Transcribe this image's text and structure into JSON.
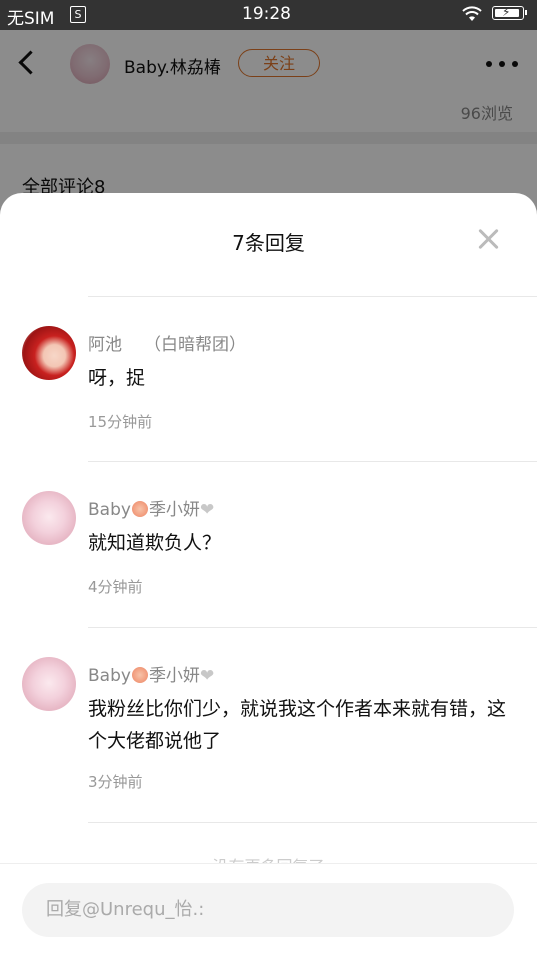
{
  "status_bar": {
    "carrier": "无SIM",
    "carrier_badge": "S",
    "time": "19:28",
    "wifi_icon": "wifi-icon",
    "battery_icon": "battery-charging-icon",
    "battery_bolt": "⚡"
  },
  "post_header": {
    "author_name": "Baby.林劦椿",
    "follow_label": "关注",
    "views": "96浏览",
    "accent_color": "#e0762c"
  },
  "comments_section": {
    "title": "全部评论8"
  },
  "sheet": {
    "title": "7条回复",
    "close_icon": "close-icon",
    "replies": [
      {
        "username": "阿池",
        "tag": "（白暗帮团）",
        "text": "呀，捉",
        "time": "15分钟前"
      },
      {
        "username_prefix": "Baby",
        "username_suffix": "季小妍",
        "heart": "❤",
        "text": "就知道欺负人？",
        "time": "4分钟前"
      },
      {
        "username_prefix": "Baby",
        "username_suffix": "季小妍",
        "heart": "❤",
        "text": "我粉丝比你们少，就说我这个作者本来就有错，这个大佬都说他了",
        "time": "3分钟前"
      }
    ],
    "no_more": "没有更多回复了"
  },
  "reply_input": {
    "placeholder": "回复@Unrequ_怡.:"
  }
}
